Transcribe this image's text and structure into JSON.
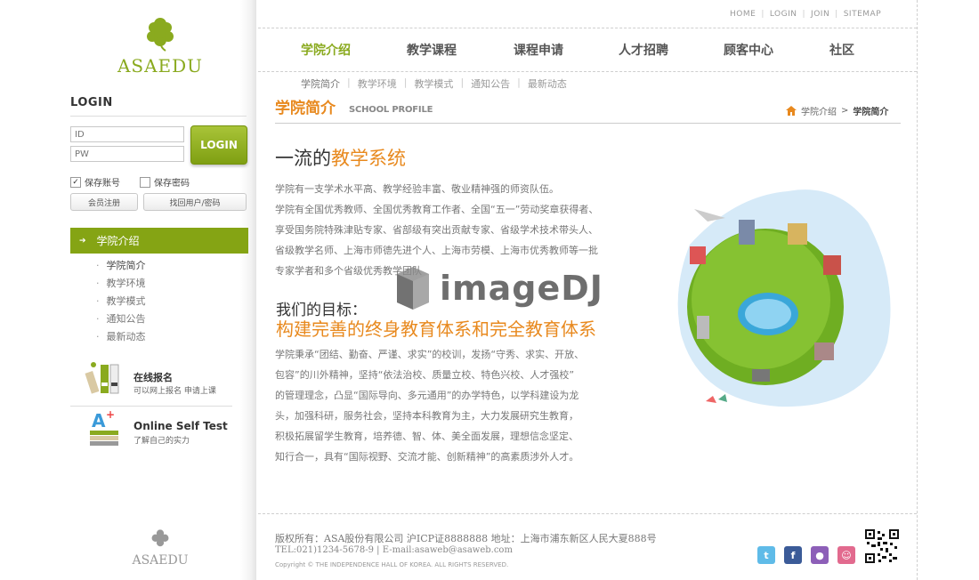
{
  "brand": {
    "name": "ASAEDU",
    "accent": "#8aaa1f",
    "orange": "#e8891e"
  },
  "top_links": [
    "HOME",
    "LOGIN",
    "JOIN",
    "SITEMAP"
  ],
  "nav": [
    "学院介绍",
    "教学课程",
    "课程申请",
    "人才招聘",
    "顾客中心",
    "社区"
  ],
  "subnav": [
    "学院简介",
    "教学环境",
    "教学模式",
    "通知公告",
    "最新动态"
  ],
  "login": {
    "title": "LOGIN",
    "id_placeholder": "ID",
    "pw_placeholder": "PW",
    "button": "LOGIN",
    "save_account": "保存账号",
    "save_password": "保存密码",
    "register": "会员注册",
    "recover": "找回用户/密码"
  },
  "side_menu": {
    "title": "学院介绍",
    "items": [
      "学院简介",
      "教学环境",
      "教学模式",
      "通知公告",
      "最新动态"
    ]
  },
  "promos": [
    {
      "title": "在线报名",
      "sub": "可以网上报名 申请上课"
    },
    {
      "title": "Online Self Test",
      "sub": "了解自己的实力"
    }
  ],
  "section": {
    "title": "学院简介",
    "title_en": "SCHOOL PROFILE"
  },
  "breadcrumb": {
    "parent": "学院介绍",
    "sep": ">",
    "current": "学院简介"
  },
  "content": {
    "heading_plain": "一流的",
    "heading_highlight": "教学系统",
    "para1": [
      "学院有一支学术水平高、教学经验丰富、敬业精神强的师资队伍。",
      "学院有全国优秀教师、全国优秀教育工作者、全国“五一”劳动奖章获得者、",
      "享受国务院特殊津贴专家、省部级有突出贡献专家、省级学术技术带头人、",
      "省级教学名师、上海市师德先进个人、上海市劳模、上海市优秀教师等一批",
      "专家学者和多个省级优秀教学团队"
    ],
    "goal_label": "我们的目标：",
    "goal_text": "构建完善的终身教育体系和完全教育体系",
    "para2": [
      "学院秉承“团结、勤奋、严谨、求实”的校训，发扬“守秀、求实、开放、",
      "包容”的川外精神，坚持“依法治校、质量立校、特色兴校、人才强校”",
      "的管理理念，凸显“国际导向、多元通用”的办学特色，以学科建设为龙",
      "头，加强科研，服务社会，坚持本科教育为主，大力发展研究生教育，",
      "积极拓展留学生教育，培养德、智、体、美全面发展，理想信念坚定、",
      "知行合一，具有“国际视野、交流才能、创新精神”的高素质涉外人才。"
    ]
  },
  "watermark": "imageDJ",
  "footer": {
    "line1": "版权所有：ASA股份有限公司  沪ICP证8888888  地址：上海市浦东新区人民大夏888号",
    "line2": "TEL:021)1234-5678-9  |  E-mail:asaweb@asaweb.com",
    "line3": "Copyright © THE INDEPENDENCE HALL OF KOREA. ALL RIGHTS RESERVED.",
    "social": [
      "twitter-icon",
      "facebook-icon",
      "blog-icon",
      "cyworld-icon"
    ]
  }
}
